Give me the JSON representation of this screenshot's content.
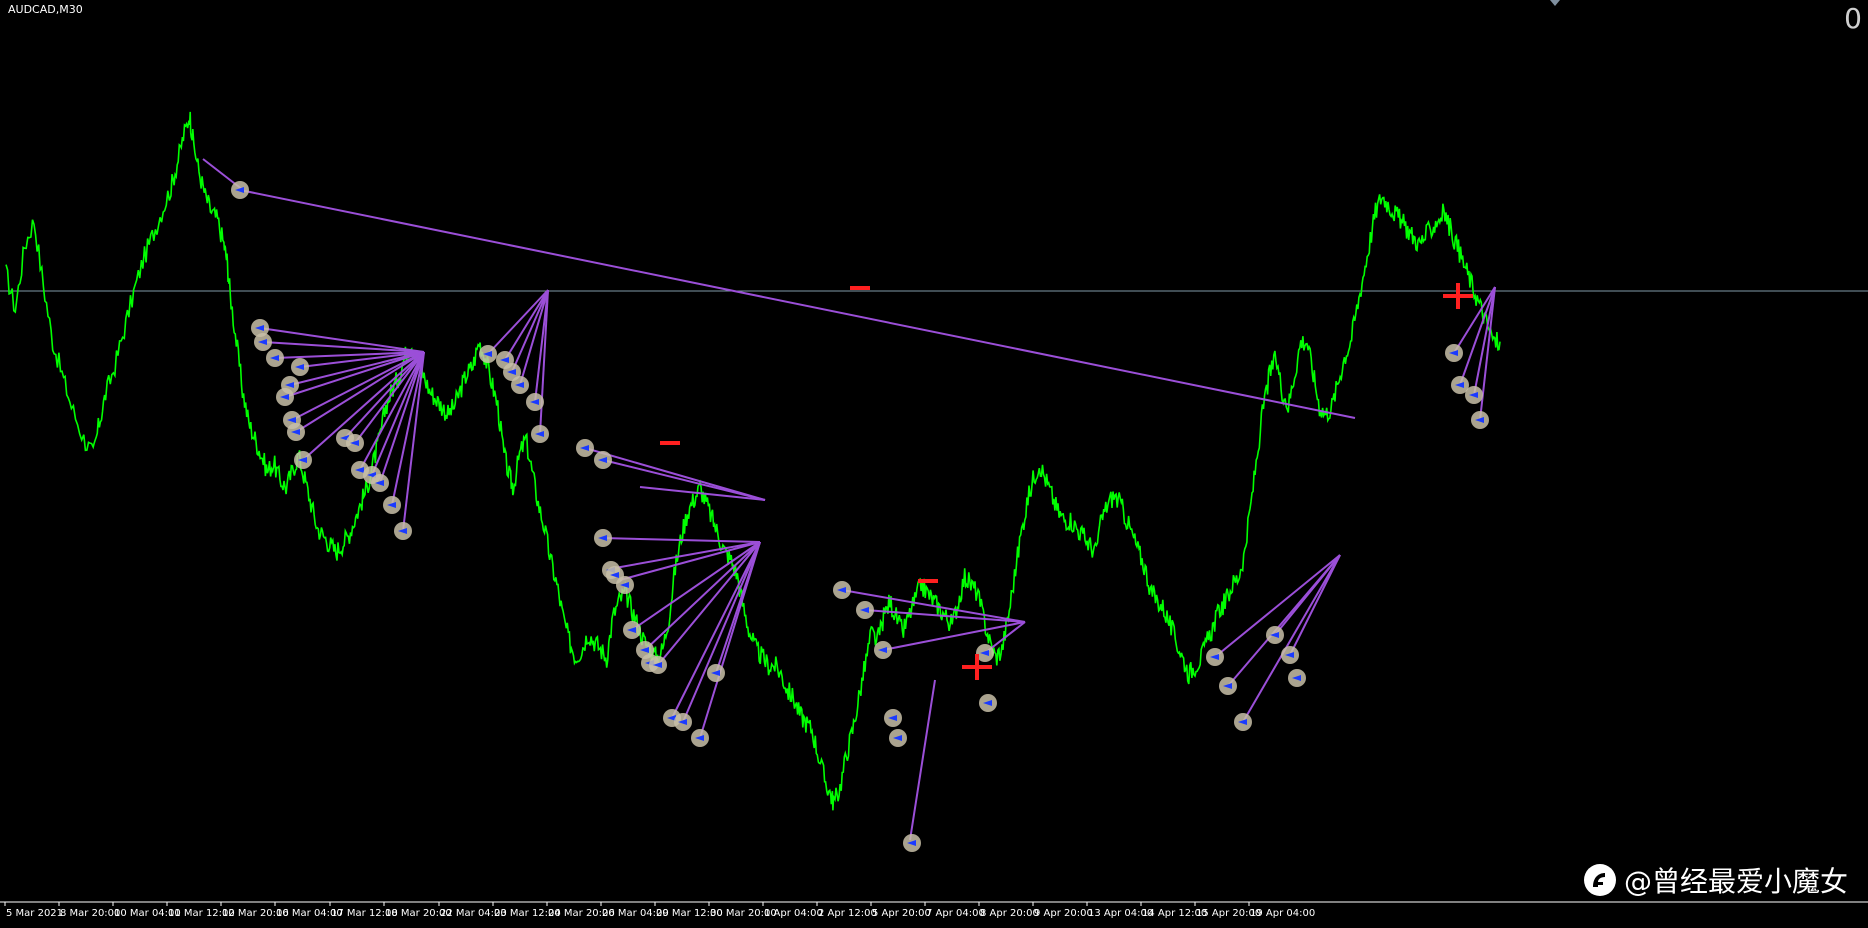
{
  "symbol": "AUDCAD,M30",
  "counter": "0",
  "watermark": {
    "text": "@曾经最爱小魔女"
  },
  "colors": {
    "background": "#000000",
    "price_line": "#00ff00",
    "trend_line": "#9b4fd8",
    "level_line": "#7f9aa8",
    "marker": "#c8c0a8",
    "marker_arrow": "#1a3aff",
    "sign": "#ff2020"
  },
  "chart_data": {
    "type": "line",
    "title": "",
    "xlabel": "",
    "ylabel": "",
    "x_ticks": [
      "5 Mar 2021",
      "8 Mar 20:00",
      "10 Mar 04:00",
      "11 Mar 12:00",
      "12 Mar 20:00",
      "16 Mar 04:00",
      "17 Mar 12:00",
      "18 Mar 20:00",
      "22 Mar 04:00",
      "23 Mar 12:00",
      "24 Mar 20:00",
      "26 Mar 04:00",
      "29 Mar 12:00",
      "30 Mar 20:00",
      "1 Apr 04:00",
      "2 Apr 12:00",
      "5 Apr 20:00",
      "7 Apr 04:00",
      "8 Apr 20:00",
      "9 Apr 20:00",
      "13 Apr 04:00",
      "14 Apr 12:00",
      "15 Apr 20:00",
      "19 Apr 04:00"
    ],
    "ylim": [
      0,
      1000
    ],
    "series": [
      {
        "values": [
          [
            0,
            725
          ],
          [
            3,
            680
          ],
          [
            6,
            758
          ],
          [
            9,
            790
          ],
          [
            12,
            710
          ],
          [
            15,
            640
          ],
          [
            18,
            600
          ],
          [
            21,
            560
          ],
          [
            25,
            520
          ],
          [
            28,
            500
          ],
          [
            30,
            540
          ],
          [
            32,
            575
          ],
          [
            35,
            610
          ],
          [
            38,
            655
          ],
          [
            41,
            700
          ],
          [
            44,
            740
          ],
          [
            47,
            770
          ],
          [
            50,
            800
          ],
          [
            53,
            830
          ],
          [
            55,
            860
          ],
          [
            57,
            893
          ],
          [
            59,
            920
          ],
          [
            60,
            890
          ],
          [
            62,
            850
          ],
          [
            64,
            820
          ],
          [
            66,
            800
          ],
          [
            68,
            790
          ],
          [
            70,
            760
          ],
          [
            71,
            740
          ],
          [
            72,
            700
          ],
          [
            74,
            640
          ],
          [
            76,
            580
          ],
          [
            78,
            540
          ],
          [
            80,
            520
          ],
          [
            82,
            500
          ],
          [
            84,
            480
          ],
          [
            86,
            490
          ],
          [
            88,
            470
          ],
          [
            90,
            460
          ],
          [
            92,
            480
          ],
          [
            94,
            500
          ],
          [
            96,
            470
          ],
          [
            98,
            440
          ],
          [
            100,
            410
          ],
          [
            102,
            400
          ],
          [
            104,
            390
          ],
          [
            106,
            380
          ],
          [
            108,
            390
          ],
          [
            110,
            400
          ],
          [
            112,
            420
          ],
          [
            114,
            440
          ],
          [
            116,
            460
          ],
          [
            118,
            490
          ],
          [
            120,
            520
          ],
          [
            122,
            560
          ],
          [
            124,
            580
          ],
          [
            126,
            595
          ],
          [
            128,
            620
          ],
          [
            130,
            640
          ],
          [
            132,
            620
          ],
          [
            134,
            600
          ],
          [
            136,
            580
          ],
          [
            138,
            570
          ],
          [
            140,
            560
          ],
          [
            142,
            550
          ],
          [
            144,
            560
          ],
          [
            146,
            580
          ],
          [
            148,
            600
          ],
          [
            150,
            610
          ],
          [
            152,
            640
          ],
          [
            154,
            620
          ],
          [
            156,
            590
          ],
          [
            158,
            560
          ],
          [
            160,
            500
          ],
          [
            162,
            470
          ],
          [
            163,
            460
          ],
          [
            165,
            500
          ],
          [
            167,
            520
          ],
          [
            169,
            480
          ],
          [
            171,
            440
          ],
          [
            173,
            410
          ],
          [
            175,
            370
          ],
          [
            177,
            340
          ],
          [
            179,
            300
          ],
          [
            181,
            270
          ],
          [
            183,
            250
          ],
          [
            185,
            260
          ],
          [
            187,
            280
          ],
          [
            189,
            270
          ],
          [
            191,
            260
          ],
          [
            193,
            250
          ],
          [
            195,
            300
          ],
          [
            197,
            320
          ],
          [
            199,
            330
          ],
          [
            201,
            310
          ],
          [
            203,
            290
          ],
          [
            205,
            270
          ],
          [
            207,
            260
          ],
          [
            209,
            250
          ],
          [
            211,
            260
          ],
          [
            213,
            300
          ],
          [
            215,
            360
          ],
          [
            217,
            400
          ],
          [
            219,
            430
          ],
          [
            221,
            445
          ],
          [
            223,
            460
          ],
          [
            225,
            440
          ],
          [
            227,
            420
          ],
          [
            229,
            400
          ],
          [
            231,
            380
          ],
          [
            233,
            370
          ],
          [
            235,
            350
          ],
          [
            237,
            310
          ],
          [
            239,
            280
          ],
          [
            241,
            260
          ],
          [
            243,
            250
          ],
          [
            245,
            240
          ],
          [
            247,
            240
          ],
          [
            249,
            230
          ],
          [
            251,
            210
          ],
          [
            253,
            200
          ],
          [
            255,
            180
          ],
          [
            257,
            170
          ],
          [
            259,
            160
          ],
          [
            261,
            130
          ],
          [
            263,
            100
          ],
          [
            265,
            80
          ],
          [
            266,
            70
          ],
          [
            268,
            90
          ],
          [
            270,
            130
          ],
          [
            272,
            160
          ],
          [
            274,
            200
          ],
          [
            276,
            240
          ],
          [
            278,
            280
          ],
          [
            280,
            270
          ],
          [
            282,
            300
          ],
          [
            284,
            320
          ],
          [
            286,
            300
          ],
          [
            288,
            280
          ],
          [
            290,
            300
          ],
          [
            292,
            320
          ],
          [
            294,
            340
          ],
          [
            296,
            330
          ],
          [
            298,
            320
          ],
          [
            300,
            310
          ],
          [
            302,
            300
          ],
          [
            304,
            290
          ],
          [
            306,
            320
          ],
          [
            308,
            350
          ],
          [
            310,
            340
          ],
          [
            312,
            330
          ],
          [
            314,
            300
          ],
          [
            316,
            270
          ],
          [
            318,
            250
          ],
          [
            320,
            260
          ],
          [
            322,
            300
          ],
          [
            324,
            350
          ],
          [
            326,
            400
          ],
          [
            328,
            440
          ],
          [
            330,
            470
          ],
          [
            332,
            490
          ],
          [
            334,
            470
          ],
          [
            336,
            450
          ],
          [
            338,
            430
          ],
          [
            340,
            420
          ],
          [
            342,
            420
          ],
          [
            344,
            410
          ],
          [
            346,
            400
          ],
          [
            348,
            390
          ],
          [
            350,
            380
          ],
          [
            352,
            420
          ],
          [
            354,
            440
          ],
          [
            356,
            450
          ],
          [
            358,
            440
          ],
          [
            360,
            420
          ],
          [
            362,
            400
          ],
          [
            364,
            380
          ],
          [
            366,
            360
          ],
          [
            368,
            330
          ],
          [
            370,
            320
          ],
          [
            372,
            310
          ],
          [
            374,
            290
          ],
          [
            376,
            270
          ],
          [
            378,
            250
          ],
          [
            380,
            230
          ],
          [
            382,
            240
          ],
          [
            384,
            250
          ],
          [
            386,
            270
          ],
          [
            388,
            290
          ],
          [
            390,
            310
          ],
          [
            392,
            320
          ],
          [
            394,
            340
          ],
          [
            396,
            350
          ],
          [
            398,
            380
          ],
          [
            400,
            440
          ],
          [
            402,
            500
          ],
          [
            404,
            560
          ],
          [
            406,
            600
          ],
          [
            408,
            620
          ],
          [
            410,
            580
          ],
          [
            412,
            560
          ],
          [
            414,
            600
          ],
          [
            416,
            640
          ],
          [
            418,
            640
          ],
          [
            420,
            600
          ],
          [
            422,
            560
          ],
          [
            424,
            550
          ],
          [
            426,
            560
          ],
          [
            428,
            590
          ],
          [
            430,
            620
          ],
          [
            432,
            640
          ],
          [
            434,
            680
          ],
          [
            436,
            720
          ],
          [
            438,
            760
          ],
          [
            440,
            800
          ],
          [
            442,
            820
          ],
          [
            444,
            810
          ],
          [
            446,
            800
          ],
          [
            448,
            790
          ],
          [
            450,
            780
          ],
          [
            452,
            770
          ],
          [
            454,
            760
          ],
          [
            456,
            770
          ],
          [
            458,
            780
          ],
          [
            460,
            790
          ],
          [
            462,
            800
          ],
          [
            464,
            780
          ],
          [
            466,
            760
          ],
          [
            468,
            740
          ],
          [
            470,
            720
          ],
          [
            472,
            700
          ],
          [
            474,
            680
          ],
          [
            476,
            660
          ],
          [
            478,
            640
          ],
          [
            480,
            640
          ]
        ]
      }
    ]
  }
}
